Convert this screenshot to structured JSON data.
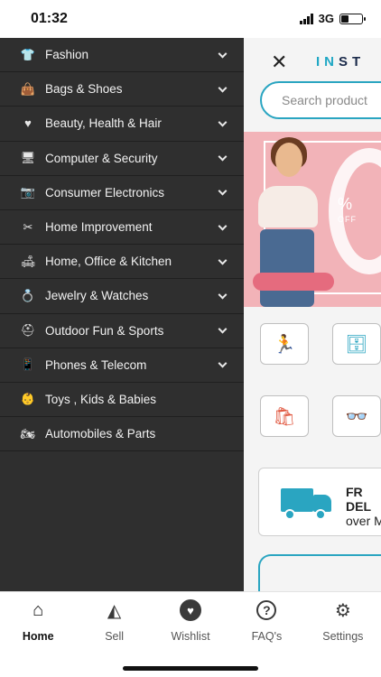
{
  "status_bar": {
    "time": "01:32",
    "network": "3G",
    "battery_level": 0.35
  },
  "drawer": {
    "items": [
      {
        "label": "Fashion",
        "icon": "tshirt-icon",
        "expandable": true
      },
      {
        "label": "Bags & Shoes",
        "icon": "bag-icon",
        "expandable": true
      },
      {
        "label": "Beauty, Health & Hair",
        "icon": "heartbeat-icon",
        "expandable": true
      },
      {
        "label": "Computer & Security",
        "icon": "monitor-icon",
        "expandable": true
      },
      {
        "label": "Consumer Electronics",
        "icon": "camera-icon",
        "expandable": true
      },
      {
        "label": "Home Improvement",
        "icon": "tools-icon",
        "expandable": true
      },
      {
        "label": "Home, Office & Kitchen",
        "icon": "sofa-icon",
        "expandable": true
      },
      {
        "label": "Jewelry & Watches",
        "icon": "ring-icon",
        "expandable": true
      },
      {
        "label": "Outdoor Fun & Sports",
        "icon": "helmet-icon",
        "expandable": true
      },
      {
        "label": "Phones & Telecom",
        "icon": "phone-icon",
        "expandable": true
      },
      {
        "label": "Toys , Kids & Babies",
        "icon": "baby-icon",
        "expandable": false
      },
      {
        "label": "Automobiles & Parts",
        "icon": "motorcycle-icon",
        "expandable": false
      }
    ]
  },
  "main": {
    "brand_part1": "IN",
    "brand_part2": "ST",
    "search_placeholder": "Search product",
    "banner_percent": "%",
    "banner_off": "OFF",
    "delivery_line1": "FR",
    "delivery_line2": "DEL",
    "delivery_line3": "over M"
  },
  "tabbar": {
    "tabs": [
      {
        "label": "Home",
        "icon": "home-icon",
        "active": true
      },
      {
        "label": "Sell",
        "icon": "chart-area-icon",
        "active": false
      },
      {
        "label": "Wishlist",
        "icon": "heart-icon",
        "active": false
      },
      {
        "label": "FAQ's",
        "icon": "question-icon",
        "active": false
      },
      {
        "label": "Settings",
        "icon": "gears-icon",
        "active": false
      }
    ]
  },
  "colors": {
    "drawer_bg": "#2f2f2f",
    "accent": "#2aa5c1",
    "banner_pink": "#f2b3b8"
  }
}
